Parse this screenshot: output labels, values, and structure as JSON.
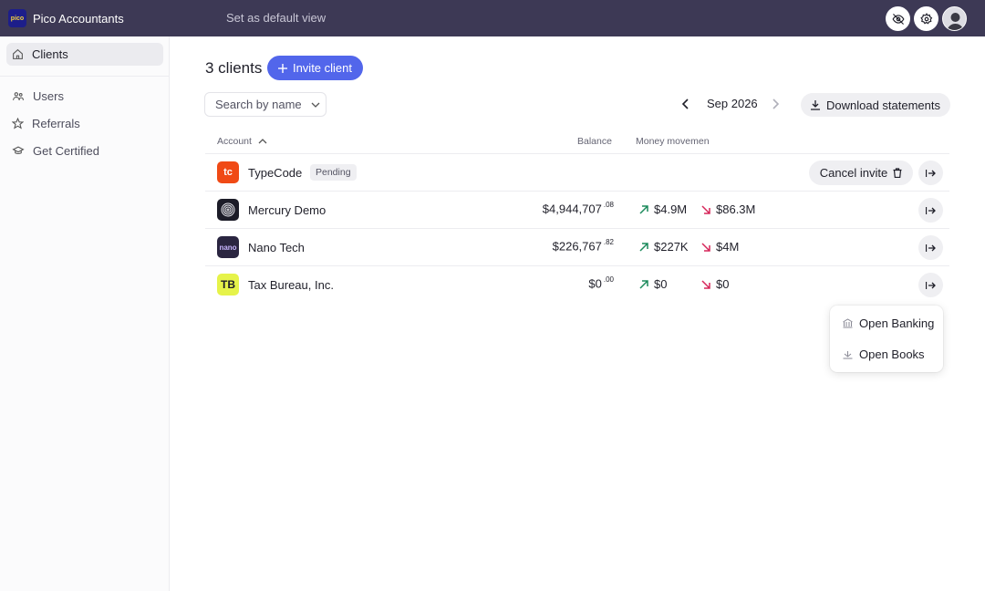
{
  "app": {
    "name": "Pico Accountants",
    "logo_text": "pico"
  },
  "topbar": {
    "default_view_label": "Set as default view"
  },
  "sidebar": {
    "items": [
      {
        "label": "Clients",
        "icon": "home-icon"
      },
      {
        "label": "Users",
        "icon": "users-icon"
      },
      {
        "label": "Referrals",
        "icon": "star-icon"
      },
      {
        "label": "Get Certified",
        "icon": "graduation-cap-icon"
      }
    ]
  },
  "main": {
    "heading": "3 clients",
    "invite_label": "Invite client",
    "search_placeholder": "Search by name",
    "month": "Sep 2026",
    "download_label": "Download statements"
  },
  "table": {
    "headers": {
      "account": "Account",
      "balance": "Balance",
      "money_movement": "Money movemen"
    },
    "rows": [
      {
        "name": "TypeCode",
        "status": "Pending",
        "cancel_label": "Cancel invite",
        "logo_text": "tc",
        "logo_bg": "#f04a15",
        "logo_fg": "#ffffff"
      },
      {
        "name": "Mercury Demo",
        "balance": "$4,944,707",
        "cents": ".08",
        "in": "$4.9M",
        "out": "$86.3M",
        "logo_bg": "#1c1c28"
      },
      {
        "name": "Nano Tech",
        "balance": "$226,767",
        "cents": ".82",
        "in": "$227K",
        "out": "$4M",
        "logo_text": "nano",
        "logo_bg": "#2a2540",
        "logo_fg": "#c9b6ff"
      },
      {
        "name": "Tax Bureau, Inc.",
        "balance": "$0",
        "cents": ".00",
        "in": "$0",
        "out": "$0",
        "logo_text": "TB",
        "logo_bg": "#e6f34a",
        "logo_fg": "#1c1c28"
      }
    ]
  },
  "menu": {
    "items": [
      "Open Banking",
      "Open Books"
    ]
  },
  "colors": {
    "topbar": "#3d3955",
    "accent": "#5266eb",
    "money_in": "#1c8a5c",
    "money_out": "#d6265a"
  }
}
